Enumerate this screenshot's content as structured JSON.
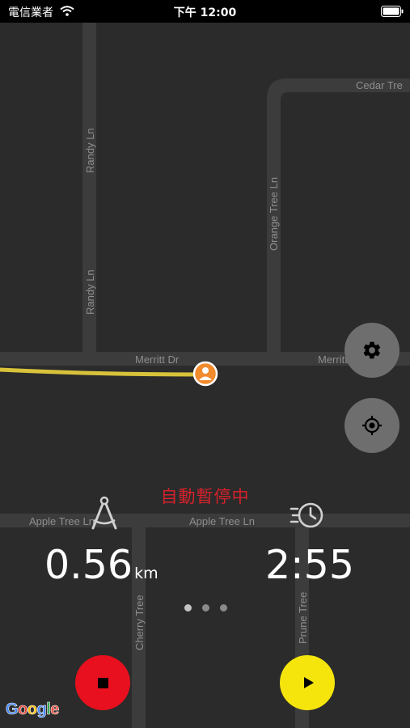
{
  "status_bar": {
    "carrier": "電信業者",
    "time": "下午 12:00",
    "icons": [
      "wifi-icon",
      "battery-icon"
    ]
  },
  "map": {
    "streets": {
      "cedar": "Cedar Tre",
      "randy_top": "Randy Ln",
      "randy_bottom": "Randy Ln",
      "orange": "Orange Tree Ln",
      "merritt_left": "Merritt Dr",
      "merritt_right": "Merritt Dr",
      "apple_left": "Apple Tree Ln",
      "apple_right": "Apple Tree Ln",
      "cherry": "Cherry Tree",
      "prune": "Prune Tree"
    },
    "route_color": "#d8c23a",
    "marker_color": "#f28a2e",
    "attribution": "Google"
  },
  "controls": {
    "settings_icon": "gear-icon",
    "locate_icon": "crosshair-icon"
  },
  "workout": {
    "status": "自動暫停中",
    "distance": {
      "value": "0.56",
      "unit": "km",
      "icon": "compass-icon"
    },
    "duration": {
      "value": "2:55",
      "icon": "fast-clock-icon"
    },
    "page": {
      "count": 3,
      "current": 1
    }
  },
  "actions": {
    "stop": {
      "icon": "stop-icon",
      "color": "#e8101e"
    },
    "resume": {
      "icon": "play-icon",
      "color": "#f5e50d"
    }
  },
  "colors": {
    "map_bg": "#2b2b2b",
    "road": "#3c3c3c",
    "status_text": "#d6212b"
  }
}
